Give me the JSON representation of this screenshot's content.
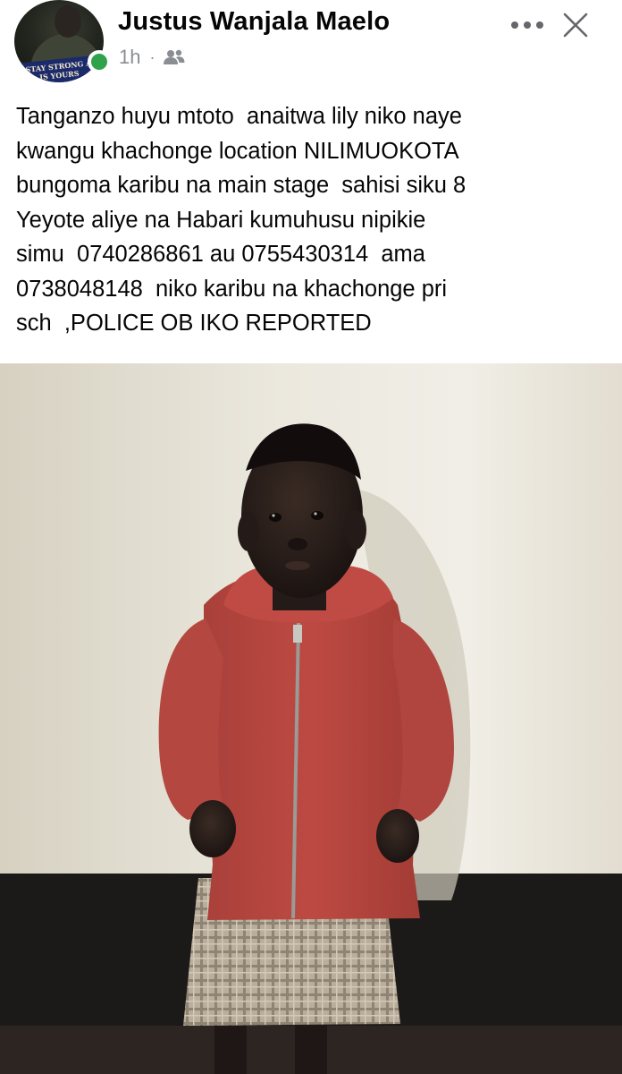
{
  "post": {
    "author": "Justus Wanjala Maelo",
    "time": "1h",
    "avatar_caption": "STAY STRONG AND STAY ... IS YOURS",
    "audience_icon": "friends-icon",
    "body_lines": [
      "Tanganzo huyu mtoto  anaitwa lily niko naye",
      "kwangu khachonge location NILIMUOKOTA",
      "bungoma karibu na main stage  sahisi siku 8",
      "Yeyote aliye na Habari kumuhusu nipikie",
      "simu  0740286861 au 0755430314  ama",
      "0738048148  niko karibu na khachonge pri",
      "sch  ,POLICE OB IKO REPORTED"
    ],
    "photo_icon": "child-photo"
  },
  "colors": {
    "text": "#050505",
    "meta": "#8a8d91",
    "online": "#31a24c",
    "hoodie": "#b5453c",
    "wall": "#ece9df",
    "floor_band": "#1b1a18"
  },
  "icons": {
    "more": "more-horizontal-icon",
    "close": "close-icon"
  }
}
